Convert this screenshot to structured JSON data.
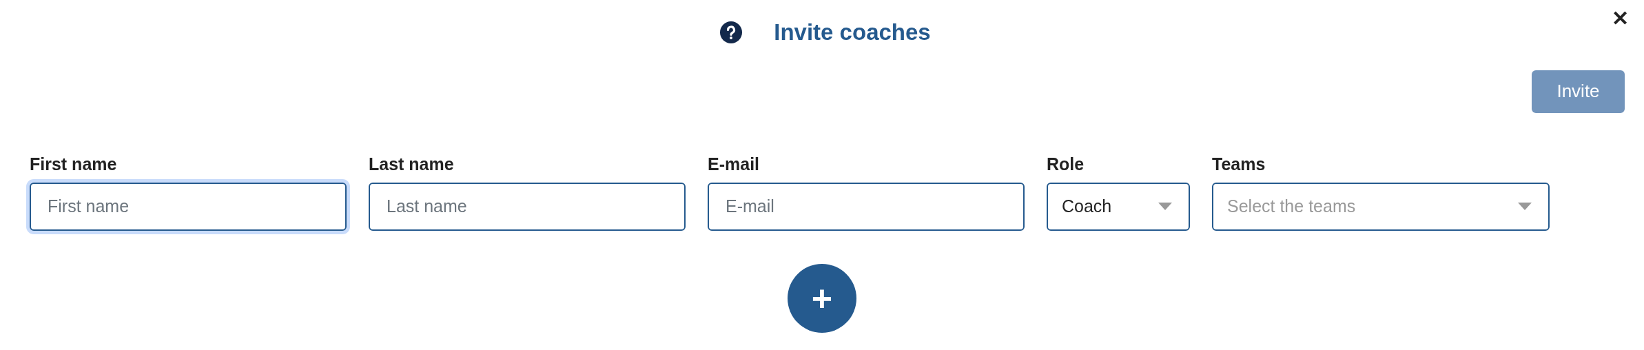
{
  "dialog": {
    "title": "Invite coaches",
    "close": "✕"
  },
  "invite_button": {
    "label": "Invite",
    "disabled": true
  },
  "fields": [
    {
      "kind": "text",
      "label": "First name",
      "placeholder": "First name",
      "focused": true
    },
    {
      "kind": "text",
      "label": "Last name",
      "placeholder": "Last name",
      "focused": false
    },
    {
      "kind": "text",
      "label": "E-mail",
      "placeholder": "E-mail",
      "focused": false
    },
    {
      "kind": "select",
      "label": "Role",
      "value": "Coach",
      "focused": false
    },
    {
      "kind": "select",
      "label": "Teams",
      "placeholder": "Select the teams",
      "focused": false
    }
  ],
  "add_button": {
    "label": "+"
  }
}
